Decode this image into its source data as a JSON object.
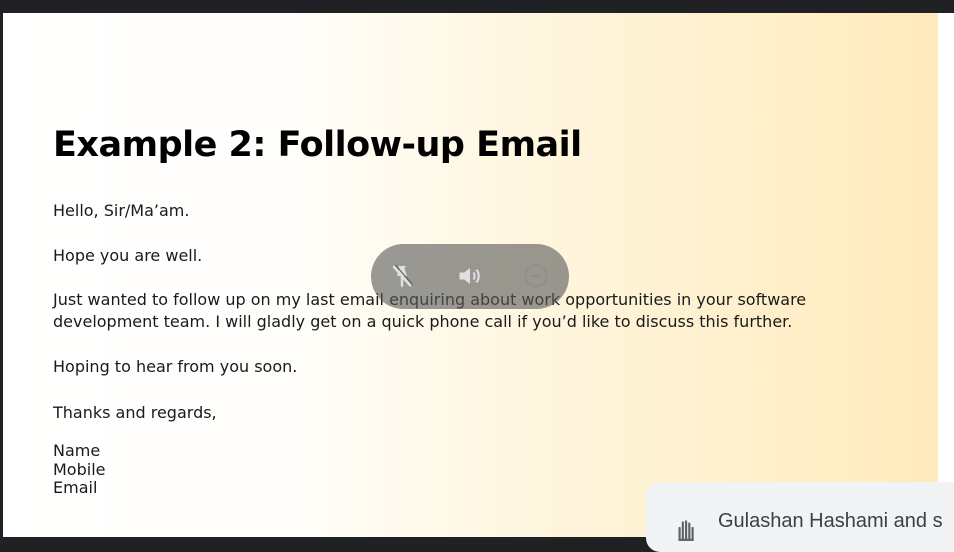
{
  "slide": {
    "title": "Example 2: Follow-up Email",
    "greeting": "Hello, Sir/Ma’am.",
    "line_wellbeing": "Hope you are well.",
    "body_line_1": "Just wanted to follow up on my last email enquiring about work opportunities in your software",
    "body_line_2": "development team. I will gladly get on a quick phone call if you’d like to discuss this further.",
    "closing_hope": "Hoping to hear from you soon.",
    "sign_off": "Thanks and regards,",
    "signature_name": "Name",
    "signature_mobile": "Mobile",
    "signature_email": "Email"
  },
  "overlay": {
    "buttons": [
      "unpin-icon",
      "volume-icon",
      "remove-icon"
    ]
  },
  "toast": {
    "text": "Gulashan Hashami and s",
    "icon": "raised-hand-icon"
  },
  "colors": {
    "window_frame": "#202124",
    "gradient_end": "#ffeabb",
    "overlay_bg": "#5a5a5a",
    "toast_bg": "#f1f3f4"
  }
}
